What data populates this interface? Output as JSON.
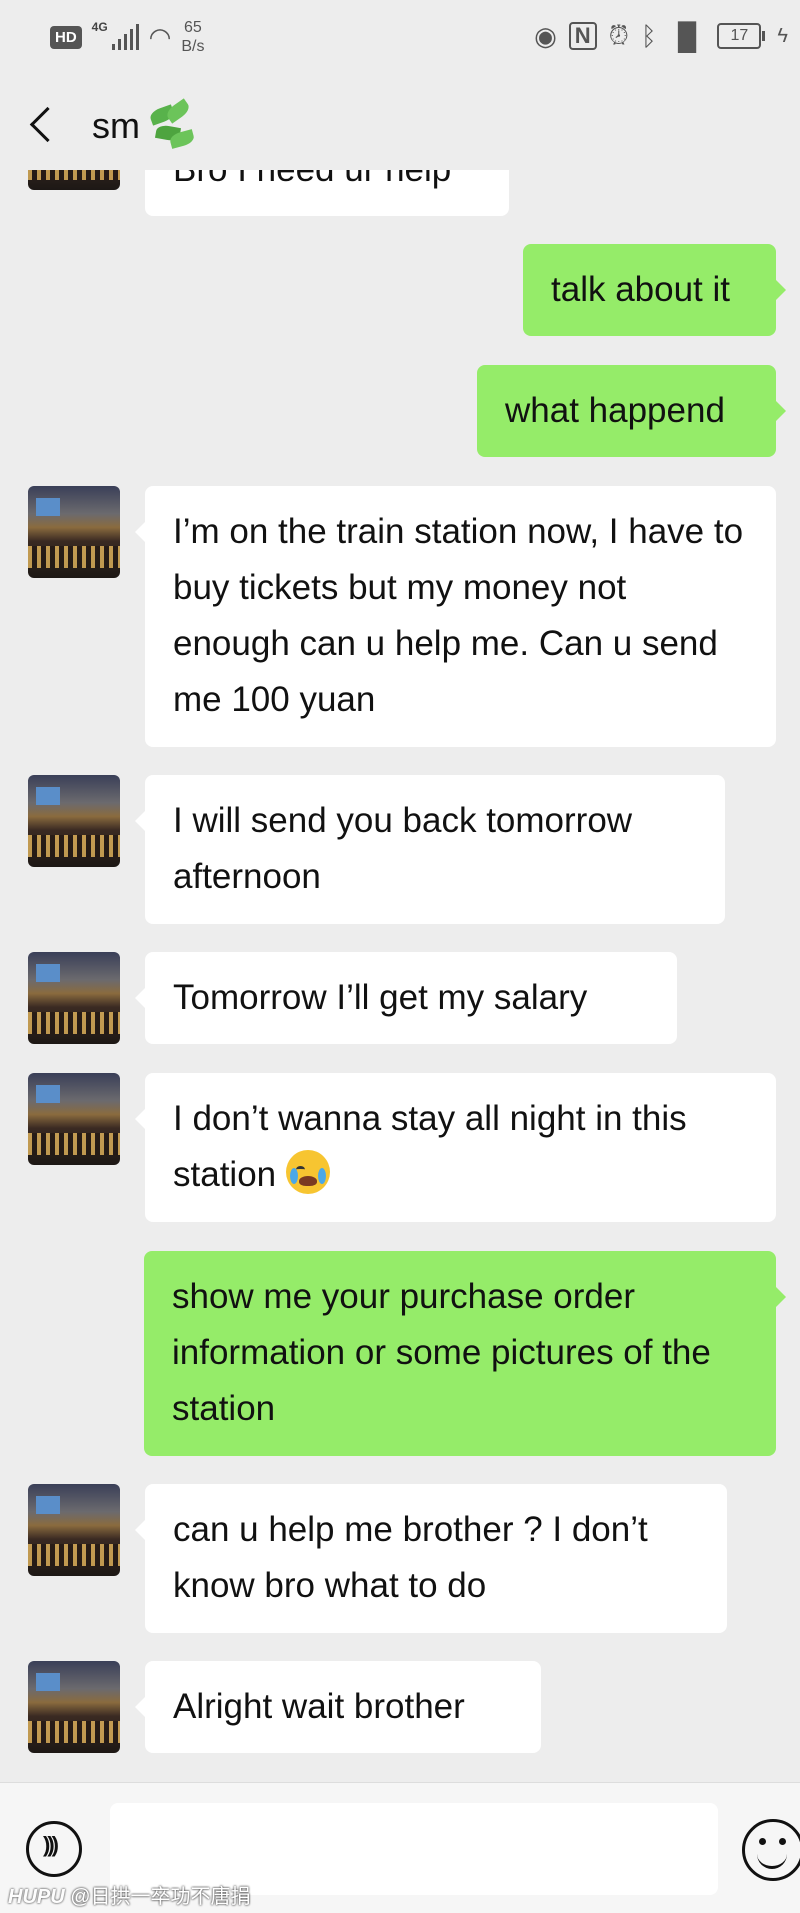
{
  "status_bar": {
    "hd": "HD",
    "network": "4G",
    "speed_value": "65",
    "speed_unit": "B/s",
    "battery": "17"
  },
  "header": {
    "back_icon": "chevron-left-icon",
    "contact_name": "sm"
  },
  "messages": [
    {
      "side": "in",
      "text": "Bro I need ur help"
    },
    {
      "side": "out",
      "text": "talk about it"
    },
    {
      "side": "out",
      "text": "what happend"
    },
    {
      "side": "in",
      "text": "I’m on the train station now, I have to buy tickets but my money not enough can u help me. Can u send me 100 yuan"
    },
    {
      "side": "in",
      "text": "I will send you back tomorrow afternoon"
    },
    {
      "side": "in",
      "text": "Tomorrow I’ll get my salary"
    },
    {
      "side": "in",
      "text": "I don’t wanna stay all night in this station",
      "emoji": "crying-face-icon"
    },
    {
      "side": "out",
      "text": "show me your purchase order information or some pictures of the station"
    },
    {
      "side": "in",
      "text": "can u help me brother ? I don’t know bro what to do"
    },
    {
      "side": "in",
      "text": "Alright wait brother"
    }
  ],
  "input_bar": {
    "voice_icon": "voice-icon",
    "emoji_icon": "smiley-icon",
    "text_value": ""
  },
  "watermark": {
    "brand": "HUPU",
    "handle": "@日拱一卒功不唐捐"
  },
  "colors": {
    "background": "#ededed",
    "outgoing_bubble": "#95ec69",
    "incoming_bubble": "#ffffff"
  }
}
